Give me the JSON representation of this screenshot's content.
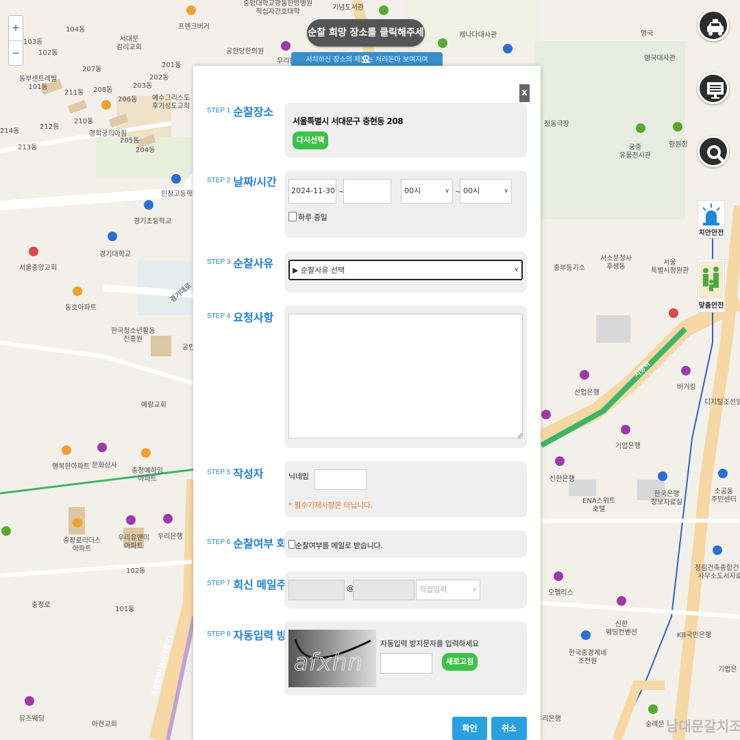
{
  "map": {
    "zoom_in": "+",
    "zoom_out": "−",
    "banner": "순찰 희망 장소를 클릭해주세요",
    "subbanner": "서치하신 장소의 제보는 처리돈아 보여지며",
    "labels": [
      {
        "t": "104동"
      },
      {
        "t": "103동"
      },
      {
        "t": "102동"
      },
      {
        "t": "동부센트레빌\n101동"
      },
      {
        "t": "서대문\n감리교회"
      },
      {
        "t": "프렌크버거"
      },
      {
        "t": "공안당한의원"
      },
      {
        "t": "중앙대학교광동한방병원\n적십자간호대학"
      },
      {
        "t": "기념도서관"
      },
      {
        "t": "우리은행"
      },
      {
        "t": "캐나다대사관"
      },
      {
        "t": "영국"
      },
      {
        "t": "영국대사관"
      },
      {
        "t": "207동"
      },
      {
        "t": "201동"
      },
      {
        "t": "202동"
      },
      {
        "t": "203동"
      },
      {
        "t": "211동"
      },
      {
        "t": "208동"
      },
      {
        "t": "206동"
      },
      {
        "t": "예수그리스도\n후기성도교회"
      },
      {
        "t": "214동"
      },
      {
        "t": "212동"
      },
      {
        "t": "210동"
      },
      {
        "t": "경희궁의아침"
      },
      {
        "t": "205동"
      },
      {
        "t": "204동"
      },
      {
        "t": "213동"
      },
      {
        "t": "인창고등학교"
      },
      {
        "t": "경기초등학교"
      },
      {
        "t": "경기대학교"
      },
      {
        "t": "서울중앙교회"
      },
      {
        "t": "동호아파트"
      },
      {
        "t": "한국청소년활동\n진흥원"
      },
      {
        "t": "예랑교회"
      },
      {
        "t": "행복한아파트"
      },
      {
        "t": "문화상사"
      },
      {
        "t": "충정예하임\n아파트"
      },
      {
        "t": "충정로리더스\n아파트"
      },
      {
        "t": "우리유앤미\n아파트"
      },
      {
        "t": "우리은행"
      },
      {
        "t": "102동"
      },
      {
        "t": "101동"
      },
      {
        "t": "충정로"
      },
      {
        "t": "뮤즈웨딩"
      },
      {
        "t": "아현교회"
      },
      {
        "t": "정동극장"
      },
      {
        "t": "궁중\n유물전시관"
      },
      {
        "t": "향원정"
      },
      {
        "t": "중부등기소"
      },
      {
        "t": "서소문청사\n후생동"
      },
      {
        "t": "서울\n특별시청원관"
      },
      {
        "t": "산업은행"
      },
      {
        "t": "버거킹"
      },
      {
        "t": "디지털조선일"
      },
      {
        "t": "기업은행"
      },
      {
        "t": "신한은행"
      },
      {
        "t": "ENA스위트\n호텔"
      },
      {
        "t": "한국은행\n정보자료실"
      },
      {
        "t": "소공동\n주민센터"
      },
      {
        "t": "오펠리스"
      },
      {
        "t": "정림건축종합건축\n사무소도서자료"
      },
      {
        "t": "한국중경계네\n조전원"
      },
      {
        "t": "신한\n웨딩컨벤션"
      },
      {
        "t": "KB국민은행"
      },
      {
        "t": "기업은"
      },
      {
        "t": "숭례문"
      },
      {
        "t": "남대문갈치조"
      },
      {
        "t": "시청역"
      },
      {
        "t": "경기대로"
      },
      {
        "t": "우리은행"
      },
      {
        "t": "공인"
      },
      {
        "t": "충정로역(경기대입구)"
      }
    ],
    "tools": {
      "police_car": "police-car",
      "monitor": "monitor",
      "search": "search",
      "safety_card": "치안안전",
      "custom_card": "맞춤안전"
    }
  },
  "modal": {
    "close": "x",
    "steps": [
      {
        "no": "STEP 1",
        "title": "순찰장소"
      },
      {
        "no": "STEP 2",
        "title": "날짜/시간"
      },
      {
        "no": "STEP 3",
        "title": "순찰사유"
      },
      {
        "no": "STEP 4",
        "title": "요청사항"
      },
      {
        "no": "STEP 5",
        "title": "작성자"
      },
      {
        "no": "STEP 6",
        "title": "순찰여부 회신"
      },
      {
        "no": "STEP 7",
        "title": "회신 메일주소"
      },
      {
        "no": "STEP 8",
        "title": "자동입력 방지"
      }
    ],
    "step1": {
      "address": "서울특별시 서대문구 충현동 208",
      "reselect": "다시선택"
    },
    "step2": {
      "start_date": "2024-11-30",
      "tilde": "~",
      "end_date": "",
      "start_hour": "00시",
      "end_hour": "00시",
      "all_day": "하루 종일"
    },
    "step3": {
      "reason_select": "▶ 순찰사유 선택"
    },
    "step4": {
      "request_text": ""
    },
    "step5": {
      "nickname_label": "닉네임",
      "nickname": "",
      "note": "* 필수기재사항은 아닙니다."
    },
    "step6": {
      "mail_reply": "순찰여부를 메일로 받습니다."
    },
    "step7": {
      "email_id": "",
      "at": "@",
      "email_domain": "",
      "domain_select": "직접입력"
    },
    "step8": {
      "captcha_text": "afxhn",
      "prompt": "자동입력 방지문자를 입력하세요",
      "captcha_input": "",
      "refresh": "새로고침"
    },
    "confirm": "확인",
    "cancel": "취소"
  }
}
